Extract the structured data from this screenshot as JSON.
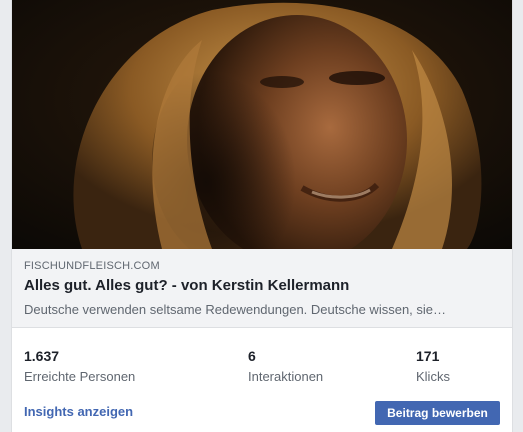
{
  "link_preview": {
    "domain": "FISCHUNDFLEISCH.COM",
    "title": "Alles gut. Alles gut? - von Kerstin Kellermann",
    "description": "Deutsche verwenden seltsame Redewendungen. Deutsche wissen, sie…"
  },
  "stats": [
    {
      "value": "1.637",
      "label": "Erreichte Personen"
    },
    {
      "value": "6",
      "label": "Interaktionen"
    },
    {
      "value": "171",
      "label": "Klicks"
    }
  ],
  "actions": {
    "insights_label": "Insights anzeigen",
    "promote_label": "Beitrag bewerben"
  },
  "colors": {
    "accent": "#4267b2",
    "link_background": "#f2f3f5",
    "text_primary": "#1d2129",
    "text_secondary": "#606770"
  }
}
